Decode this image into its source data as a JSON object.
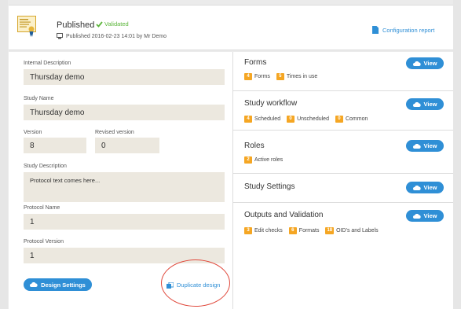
{
  "header": {
    "status_title": "Published",
    "validated_label": "Validated",
    "published_line": "Published 2016-02-23 14:01 by Mr Demo",
    "config_report_label": "Configuration report"
  },
  "form": {
    "internal_description": {
      "label": "Internal Description",
      "value": "Thursday demo"
    },
    "study_name": {
      "label": "Study Name",
      "value": "Thursday demo"
    },
    "version": {
      "label": "Version",
      "value": "8"
    },
    "revised_version": {
      "label": "Revised version",
      "value": "0"
    },
    "study_description": {
      "label": "Study Description",
      "value": "Protocol text comes here..."
    },
    "protocol_name": {
      "label": "Protocol Name",
      "value": "1"
    },
    "protocol_version": {
      "label": "Protocol Version",
      "value": "1"
    },
    "design_settings_label": "Design Settings",
    "duplicate_design_label": "Duplicate design"
  },
  "sections": [
    {
      "title": "Forms",
      "view_label": "View",
      "stats": [
        {
          "count": "4",
          "label": "Forms"
        },
        {
          "count": "5",
          "label": "Times in use"
        }
      ]
    },
    {
      "title": "Study workflow",
      "view_label": "View",
      "stats": [
        {
          "count": "4",
          "label": "Scheduled"
        },
        {
          "count": "0",
          "label": "Unscheduled"
        },
        {
          "count": "0",
          "label": "Common"
        }
      ]
    },
    {
      "title": "Roles",
      "view_label": "View",
      "stats": [
        {
          "count": "2",
          "label": "Active roles"
        }
      ]
    },
    {
      "title": "Study Settings",
      "view_label": "View",
      "stats": []
    },
    {
      "title": "Outputs and Validation",
      "view_label": "View",
      "stats": [
        {
          "count": "3",
          "label": "Edit checks"
        },
        {
          "count": "6",
          "label": "Formats"
        },
        {
          "count": "18",
          "label": "OID's and Labels"
        }
      ]
    }
  ],
  "colors": {
    "accent": "#2f8fd6",
    "badge": "#f5a623",
    "validated": "#5bb53a",
    "field_bg": "#ece8df",
    "highlight_circle": "#e0483b"
  },
  "icons": {
    "document": "certificate-document-icon",
    "publish": "publish-icon",
    "report": "report-document-icon",
    "cloud": "cloud-icon",
    "duplicate": "duplicate-icon",
    "check": "check-icon"
  }
}
